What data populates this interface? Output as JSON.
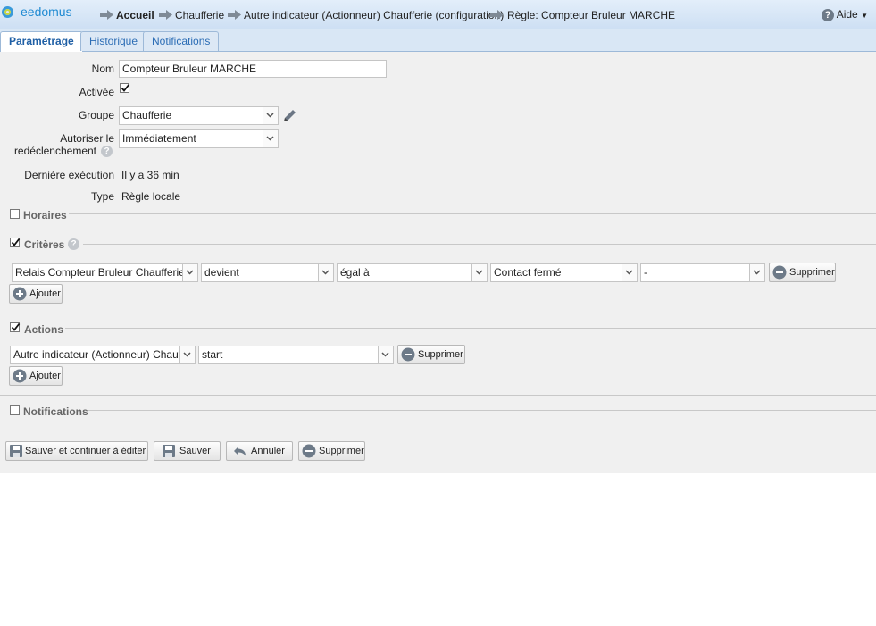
{
  "app": {
    "name": "eedomus"
  },
  "breadcrumb": [
    "Accueil",
    "Chaufferie",
    "Autre indicateur (Actionneur) Chaufferie (configuration)",
    "Règle: Compteur Bruleur MARCHE"
  ],
  "help": {
    "label": "Aide"
  },
  "tabs": [
    "Paramétrage",
    "Historique",
    "Notifications"
  ],
  "form": {
    "nom_label": "Nom",
    "nom_value": "Compteur Bruleur MARCHE",
    "activee_label": "Activée",
    "groupe_label": "Groupe",
    "groupe_value": "Chaufferie",
    "autoriser_label_1": "Autoriser le",
    "autoriser_label_2": "redéclenchement",
    "autoriser_value": "Immédiatement",
    "derniere_label": "Dernière exécution",
    "derniere_value": "Il y a 36 min",
    "type_label": "Type",
    "type_value": "Règle locale"
  },
  "sections": {
    "horaires": "Horaires",
    "criteres": "Critères",
    "actions": "Actions",
    "notifications": "Notifications"
  },
  "criteria_row": {
    "device": "Relais Compteur Bruleur Chaufferie",
    "condition": "devient",
    "operator": "égal à",
    "value": "Contact fermé",
    "extra": "-",
    "remove": "Supprimer"
  },
  "action_row": {
    "device": "Autre indicateur (Actionneur) Chaufferie",
    "value": "start",
    "remove": "Supprimer"
  },
  "add_label": "Ajouter",
  "footer": {
    "save_continue": "Sauver et continuer à éditer",
    "save": "Sauver",
    "cancel": "Annuler",
    "delete": "Supprimer"
  }
}
